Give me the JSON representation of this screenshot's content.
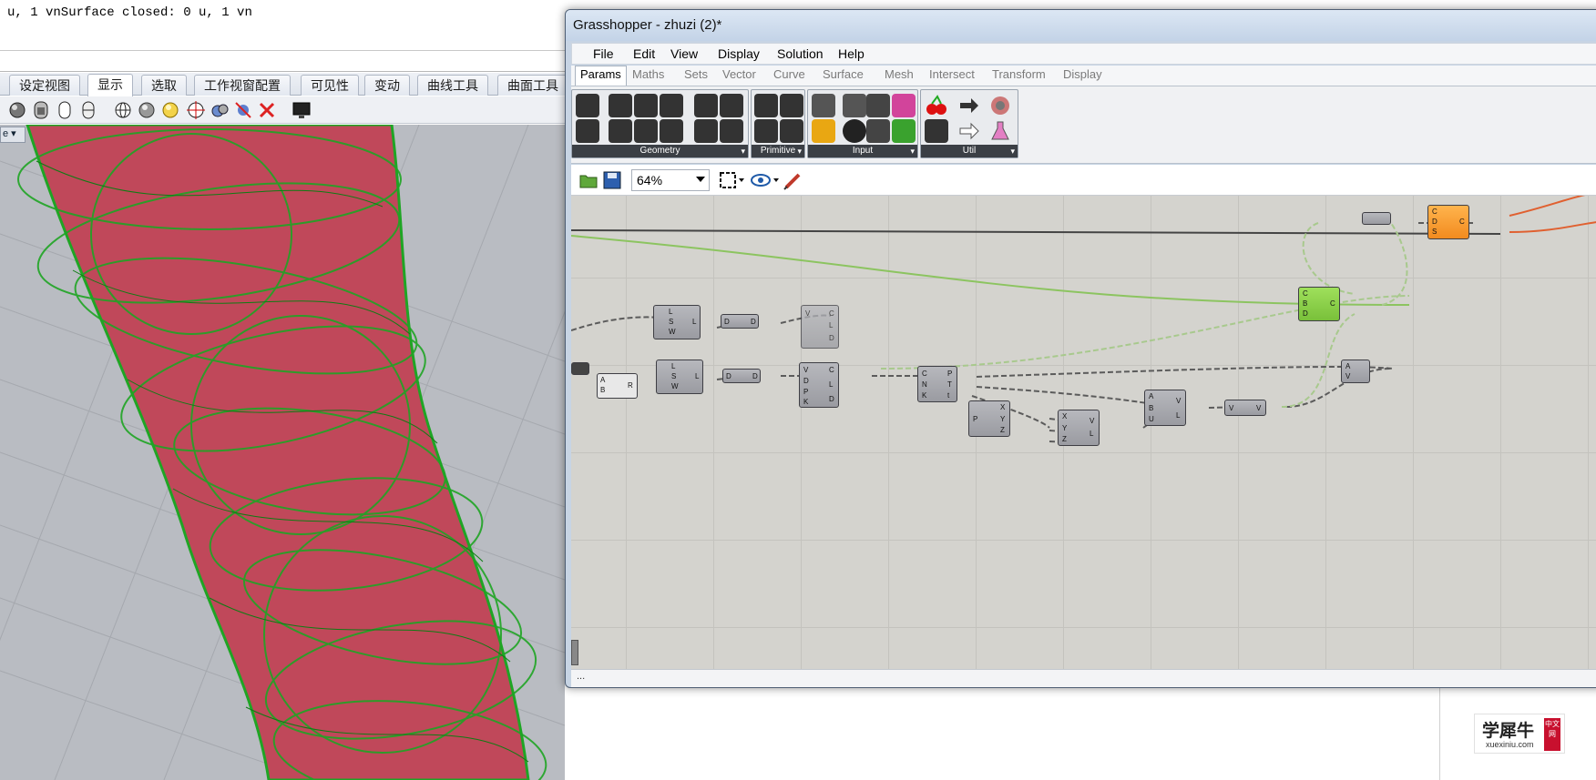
{
  "command_history": {
    "text": "u, 1 vnSurface closed: 0 u, 1 vn"
  },
  "rhino_tabs": [
    {
      "label": "设定视图",
      "active": false
    },
    {
      "label": "显示",
      "active": true
    },
    {
      "label": "选取",
      "active": false
    },
    {
      "label": "工作视窗配置",
      "active": false
    },
    {
      "label": "可见性",
      "active": false
    },
    {
      "label": "变动",
      "active": false
    },
    {
      "label": "曲线工具",
      "active": false
    },
    {
      "label": "曲面工具",
      "active": false
    }
  ],
  "rhino_toolbar_icons": [
    "render-sphere-icon",
    "object-shade-icon",
    "capsule-icon",
    "capsule-ghost-icon",
    "wireframe-globe-icon",
    "shaded-sphere-icon",
    "light-bulb-icon",
    "crosshair-icon",
    "wire-sphere-icon",
    "remove-icon",
    "x-red-icon",
    "monitor-icon"
  ],
  "viewport": {
    "label": "e",
    "background": "#b9bcc2",
    "surface_color": "#c0485a",
    "wire_color": "#1fa524"
  },
  "gh": {
    "title": "Grasshopper - zhuzi (2)*",
    "menu": [
      "File",
      "Edit",
      "View",
      "Display",
      "Solution",
      "Help"
    ],
    "tabs": [
      {
        "label": "Params",
        "active": true
      },
      {
        "label": "Maths"
      },
      {
        "label": "Sets"
      },
      {
        "label": "Vector"
      },
      {
        "label": "Curve"
      },
      {
        "label": "Surface"
      },
      {
        "label": "Mesh"
      },
      {
        "label": "Intersect"
      },
      {
        "label": "Transform"
      },
      {
        "label": "Display"
      }
    ],
    "panels": [
      {
        "label": "Geometry"
      },
      {
        "label": "Primitive"
      },
      {
        "label": "Input"
      },
      {
        "label": "Util"
      }
    ],
    "zoom": "64%",
    "status": "..."
  },
  "watermark": {
    "main": "学犀牛",
    "sub": "xuexiniu.com",
    "badge": "中文网"
  },
  "colors": {
    "accent_green": "#8fd14f",
    "accent_orange": "#f59b2c",
    "wire_gray": "#5b5b5b"
  }
}
